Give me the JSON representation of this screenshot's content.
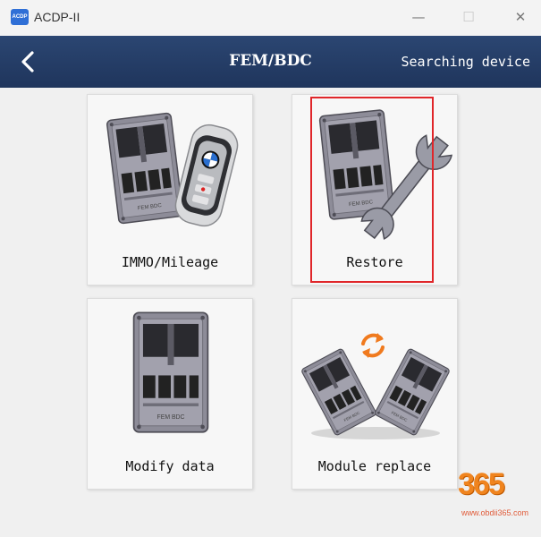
{
  "window": {
    "title": "ACDP-II",
    "logo_text": "ACDP",
    "minimize_glyph": "—",
    "maximize_glyph": "☐",
    "close_glyph": "✕"
  },
  "nav": {
    "title": "FEM/BDC",
    "status": "Searching device",
    "back_icon": "chevron-left-icon"
  },
  "tiles": [
    {
      "label": "IMMO/Mileage",
      "icon": "module-with-bmw-key-icon"
    },
    {
      "label": "Restore",
      "icon": "module-with-wrench-icon",
      "highlighted": true
    },
    {
      "label": "Modify data",
      "icon": "module-icon"
    },
    {
      "label": "Module replace",
      "icon": "module-swap-icon"
    }
  ],
  "module_label": "FEM BDC",
  "colors": {
    "navbar": "#2b4672",
    "module_body": "#8d8c98",
    "highlight": "#e0262a",
    "swap_arrows": "#f07a1e"
  },
  "watermark": {
    "number": "365",
    "url": "www.obdii365.com"
  }
}
